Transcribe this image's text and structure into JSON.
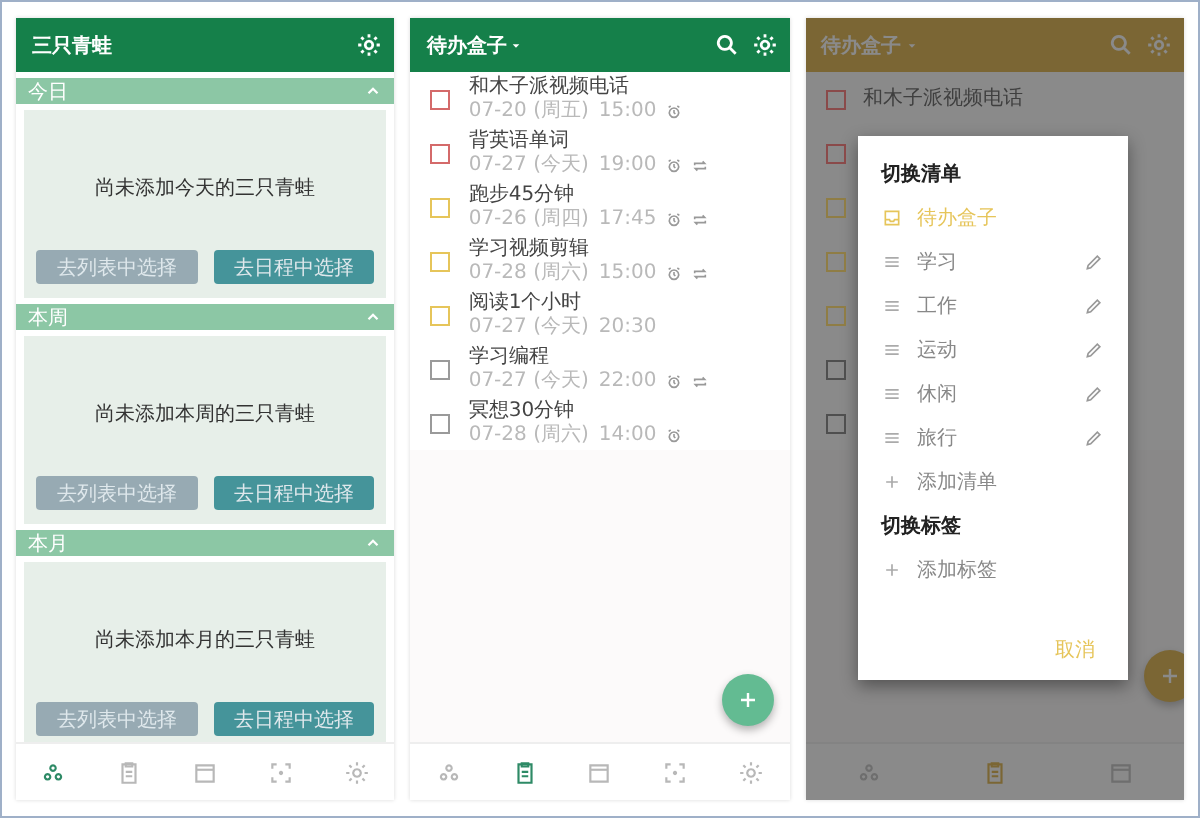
{
  "frogs_panel": {
    "title": "三只青蛙",
    "sections": [
      {
        "label": "今日",
        "expanded": true,
        "empty_text": "尚未添加今天的三只青蛙",
        "buttons": [
          "去列表中选择",
          "去日程中选择"
        ]
      },
      {
        "label": "本周",
        "expanded": true,
        "empty_text": "尚未添加本周的三只青蛙",
        "buttons": [
          "去列表中选择",
          "去日程中选择"
        ]
      },
      {
        "label": "本月",
        "expanded": true,
        "empty_text": "尚未添加本月的三只青蛙",
        "buttons": [
          "去列表中选择",
          "去日程中选择"
        ]
      }
    ],
    "nav": [
      {
        "kind": "frogs",
        "selected": true
      },
      {
        "kind": "clipboard",
        "selected": false
      },
      {
        "kind": "calendar",
        "selected": false
      },
      {
        "kind": "focus",
        "selected": false
      },
      {
        "kind": "settings",
        "selected": false
      }
    ]
  },
  "todo_panel": {
    "title": "待办盒子",
    "tasks": [
      {
        "title": "和木子派视频电话",
        "date": "07-20 (周五)",
        "time": "15:00",
        "alarm": true,
        "repeat": false,
        "color": "#d46a6a"
      },
      {
        "title": "背英语单词",
        "date": "07-27 (今天)",
        "time": "19:00",
        "alarm": true,
        "repeat": true,
        "color": "#d46a6a"
      },
      {
        "title": "跑步45分钟",
        "date": "07-26 (周四)",
        "time": "17:45",
        "alarm": true,
        "repeat": true,
        "color": "#e6c55a"
      },
      {
        "title": "学习视频剪辑",
        "date": "07-28 (周六)",
        "time": "15:00",
        "alarm": true,
        "repeat": true,
        "color": "#e6c55a"
      },
      {
        "title": "阅读1个小时",
        "date": "07-27 (今天)",
        "time": "20:30",
        "alarm": false,
        "repeat": false,
        "color": "#e6c55a"
      },
      {
        "title": "学习编程",
        "date": "07-27 (今天)",
        "time": "22:00",
        "alarm": true,
        "repeat": true,
        "color": "#9a9a9a"
      },
      {
        "title": "冥想30分钟",
        "date": "07-28 (周六)",
        "time": "14:00",
        "alarm": true,
        "repeat": false,
        "color": "#9a9a9a"
      }
    ],
    "nav": [
      {
        "kind": "frogs",
        "selected": false
      },
      {
        "kind": "clipboard",
        "selected": true
      },
      {
        "kind": "calendar",
        "selected": false
      },
      {
        "kind": "focus",
        "selected": false
      },
      {
        "kind": "settings",
        "selected": false
      }
    ]
  },
  "switch_panel": {
    "title": "待办盒子",
    "tasks": [
      {
        "title": "和木子派视频电话",
        "color": "#8a4a4a"
      },
      {
        "color": "#8a4a4a"
      },
      {
        "color": "#8f7d45"
      },
      {
        "color": "#8f7d45"
      },
      {
        "color": "#8f7d45"
      },
      {
        "color": "#4f4f4f"
      },
      {
        "color": "#4f4f4f"
      }
    ],
    "nav": [
      {
        "kind": "frogs",
        "selected": false
      },
      {
        "kind": "clipboard",
        "selected": true
      },
      {
        "kind": "calendar",
        "selected": false
      }
    ],
    "dialog": {
      "lists_heading": "切换清单",
      "lists": [
        {
          "label": "待办盒子",
          "selected": true,
          "editable": false
        },
        {
          "label": "学习",
          "selected": false,
          "editable": true
        },
        {
          "label": "工作",
          "selected": false,
          "editable": true
        },
        {
          "label": "运动",
          "selected": false,
          "editable": true
        },
        {
          "label": "休闲",
          "selected": false,
          "editable": true
        },
        {
          "label": "旅行",
          "selected": false,
          "editable": true
        }
      ],
      "add_list": "添加清单",
      "tags_heading": "切换标签",
      "add_tag": "添加标签",
      "cancel": "取消"
    }
  }
}
